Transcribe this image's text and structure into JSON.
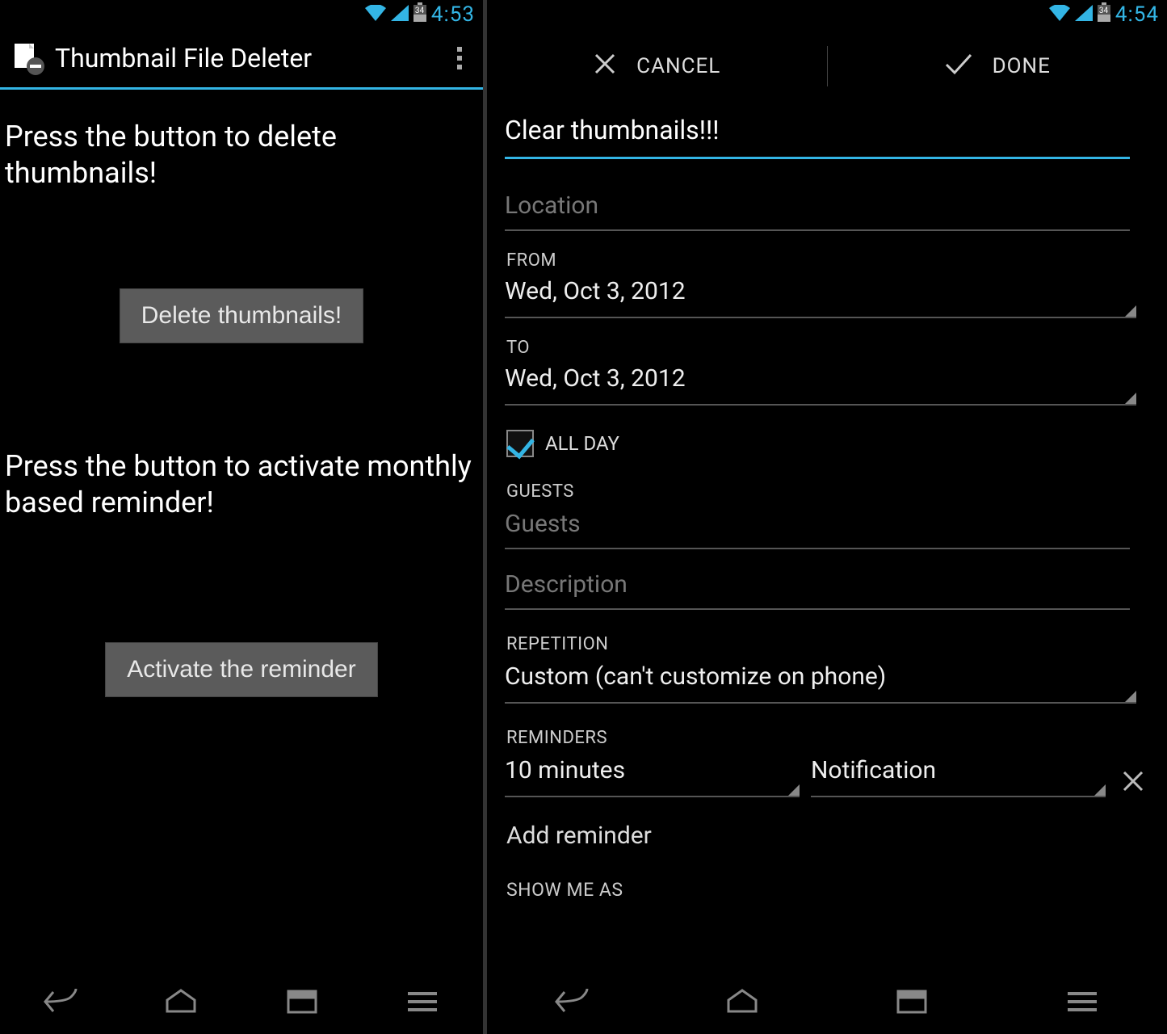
{
  "left": {
    "statusbar": {
      "battery": "34",
      "time": "4:53"
    },
    "actionbar": {
      "title": "Thumbnail File Deleter"
    },
    "instruction1": "Press the button to delete thumbnails!",
    "delete_button": "Delete thumbnails!",
    "instruction2": "Press the button to activate monthly based reminder!",
    "activate_button": "Activate the reminder"
  },
  "right": {
    "statusbar": {
      "battery": "34",
      "time": "4:54"
    },
    "header": {
      "cancel": "CANCEL",
      "done": "DONE"
    },
    "event_title": "Clear thumbnails!!!",
    "location_placeholder": "Location",
    "from_label": "FROM",
    "from_value": "Wed, Oct 3, 2012",
    "to_label": "TO",
    "to_value": "Wed, Oct 3, 2012",
    "allday_label": "ALL DAY",
    "allday_checked": true,
    "guests_label": "GUESTS",
    "guests_placeholder": "Guests",
    "description_placeholder": "Description",
    "repetition_label": "REPETITION",
    "repetition_value": "Custom (can't customize on phone)",
    "reminders_label": "REMINDERS",
    "reminder_time": "10 minutes",
    "reminder_method": "Notification",
    "add_reminder": "Add reminder",
    "show_me_as": "SHOW ME AS"
  }
}
